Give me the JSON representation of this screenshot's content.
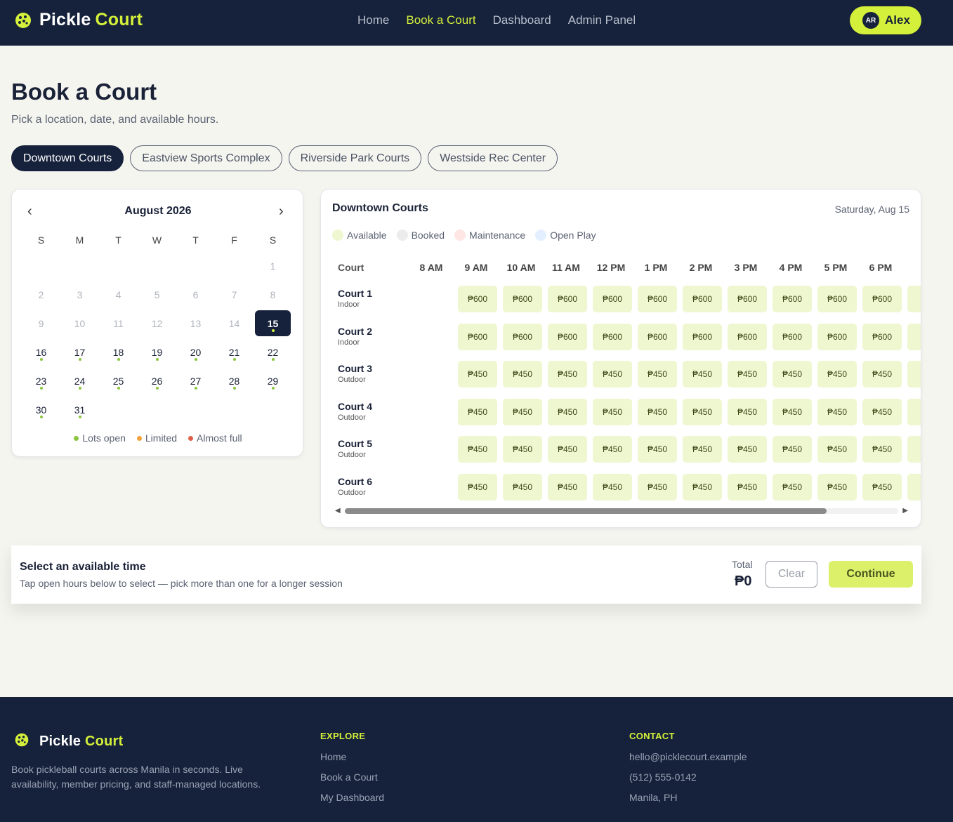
{
  "nav": {
    "brand_first": "Pickle",
    "brand_second": "Court",
    "links": [
      "Home",
      "Book a Court",
      "Dashboard",
      "Admin Panel"
    ],
    "active_link": "Book a Court",
    "user_initials": "AR",
    "user_name": "Alex"
  },
  "header": {
    "title": "Book a Court",
    "subtitle": "Pick a location, date, and available hours."
  },
  "locations": [
    "Downtown Courts",
    "Eastview Sports Complex",
    "Riverside Park Courts",
    "Westside Rec Center"
  ],
  "selected_location": "Downtown Courts",
  "calendar": {
    "month_label": "August 2026",
    "prev_icon": "‹",
    "next_icon": "›",
    "weekdays": [
      "S",
      "M",
      "T",
      "W",
      "T",
      "F",
      "S"
    ],
    "leading_blanks": 6,
    "days_in_month": 31,
    "past_through": 14,
    "selected_day": 15,
    "legend": [
      {
        "label": "Lots open",
        "color": "#8cc63f"
      },
      {
        "label": "Limited",
        "color": "#f2a23a"
      },
      {
        "label": "Almost full",
        "color": "#e0604a"
      }
    ]
  },
  "schedule": {
    "title": "Downtown Courts",
    "date_label": "Saturday, Aug 15",
    "legend": [
      {
        "label": "Available",
        "color": "#eef7cf"
      },
      {
        "label": "Booked",
        "color": "#ececec"
      },
      {
        "label": "Maintenance",
        "color": "#fde6e4"
      },
      {
        "label": "Open Play",
        "color": "#e3efff"
      }
    ],
    "court_header": "Court",
    "hours": [
      "8 AM",
      "9 AM",
      "10 AM",
      "11 AM",
      "12 PM",
      "1 PM",
      "2 PM",
      "3 PM",
      "4 PM",
      "5 PM",
      "6 PM"
    ],
    "courts": [
      {
        "name": "Court 1",
        "type": "Indoor",
        "price": "₱600"
      },
      {
        "name": "Court 2",
        "type": "Indoor",
        "price": "₱600"
      },
      {
        "name": "Court 3",
        "type": "Outdoor",
        "price": "₱450"
      },
      {
        "name": "Court 4",
        "type": "Outdoor",
        "price": "₱450"
      },
      {
        "name": "Court 5",
        "type": "Outdoor",
        "price": "₱450"
      },
      {
        "name": "Court 6",
        "type": "Outdoor",
        "price": "₱450"
      }
    ],
    "scroll_left_icon": "◀",
    "scroll_right_icon": "▶"
  },
  "selection_bar": {
    "title": "Select an available time",
    "subtitle": "Tap open hours below to select — pick more than one for a longer session",
    "total_label": "Total",
    "total_value": "₱0",
    "clear_label": "Clear",
    "continue_label": "Continue"
  },
  "footer": {
    "description": "Book pickleball courts across Manila in seconds. Live availability, member pricing, and staff-managed locations.",
    "explore_heading": "EXPLORE",
    "explore_links": [
      "Home",
      "Book a Court",
      "My Dashboard"
    ],
    "contact_heading": "CONTACT",
    "contact_items": [
      "hello@picklecourt.example",
      "(512) 555-0142",
      "Manila, PH"
    ]
  },
  "colors": {
    "navy": "#16213b",
    "lime": "#d4f03a",
    "available": "#eef7cf"
  }
}
